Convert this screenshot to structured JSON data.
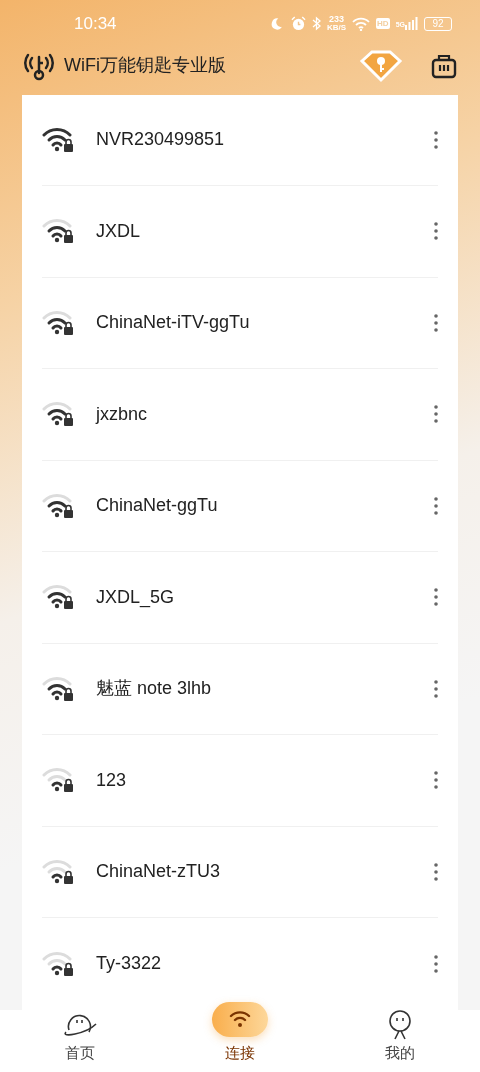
{
  "status_bar": {
    "time": "10:34",
    "speed_value": "233",
    "speed_unit": "KB/S",
    "hd": "HD",
    "network": "5G",
    "battery": "92"
  },
  "header": {
    "title": "WiFi万能钥匙专业版"
  },
  "networks": [
    {
      "name": "NVR230499851",
      "kind": "full"
    },
    {
      "name": "JXDL",
      "kind": "medium"
    },
    {
      "name": "ChinaNet-iTV-ggTu",
      "kind": "medium"
    },
    {
      "name": "jxzbnc",
      "kind": "medium"
    },
    {
      "name": "ChinaNet-ggTu",
      "kind": "medium"
    },
    {
      "name": "JXDL_5G",
      "kind": "medium"
    },
    {
      "name": "魅蓝 note 3lhb",
      "kind": "medium"
    },
    {
      "name": "123",
      "kind": "weak"
    },
    {
      "name": "ChinaNet-zTU3",
      "kind": "weak"
    },
    {
      "name": "Ty-3322",
      "kind": "weak"
    }
  ],
  "bottom_nav": [
    {
      "label": "首页",
      "kind": "home",
      "selected": false
    },
    {
      "label": "连接",
      "kind": "connect",
      "selected": true
    },
    {
      "label": "我的",
      "kind": "profile",
      "selected": false
    }
  ]
}
